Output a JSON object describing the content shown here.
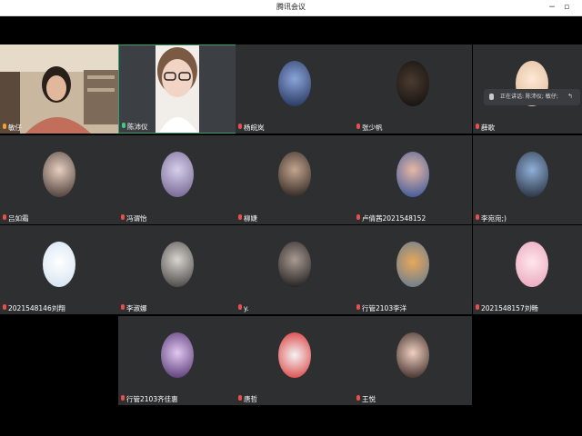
{
  "window": {
    "title": "腾讯会议"
  },
  "speaking_indicator": "正在讲话: 陈沛仪; 敏仔;",
  "colors": {
    "tile_bg": "#2e2f31",
    "active_border": "#2ea56d",
    "mic_muted": "#e94e4e",
    "mic_on": "#47c882"
  },
  "participants": [
    {
      "name": "敏仔",
      "mic": "live",
      "avatar": "bookshelf-video"
    },
    {
      "name": "陈沛仪",
      "mic": "on",
      "avatar": "face-video"
    },
    {
      "name": "杨皖岚",
      "mic": "muted",
      "avatar": "night-portrait"
    },
    {
      "name": "张少帆",
      "mic": "muted",
      "avatar": "dark-silhouette"
    },
    {
      "name": "薛歌",
      "mic": "muted",
      "avatar": "cartoon-girl"
    },
    {
      "name": "吕如霜",
      "mic": "muted",
      "avatar": "girl-photo"
    },
    {
      "name": "冯谓怡",
      "mic": "muted",
      "avatar": "purple-photo"
    },
    {
      "name": "柳婕",
      "mic": "muted",
      "avatar": "dark-girl"
    },
    {
      "name": "卢倩茜2021548152",
      "mic": "muted",
      "avatar": "blue-girl"
    },
    {
      "name": "李宛宛;)",
      "mic": "muted",
      "avatar": "blue-sky"
    },
    {
      "name": "2021548146刘翔",
      "mic": "muted",
      "avatar": "cartoon-sticker"
    },
    {
      "name": "李淑娜",
      "mic": "muted",
      "avatar": "mono-photo"
    },
    {
      "name": "y.",
      "mic": "muted",
      "avatar": "night-girl"
    },
    {
      "name": "行管2103李洋",
      "mic": "muted",
      "avatar": "mountain"
    },
    {
      "name": "2021548157刘畅",
      "mic": "muted",
      "avatar": "pink-fox"
    },
    {
      "name": "行管2103齐佳惠",
      "mic": "muted",
      "avatar": "purple-night"
    },
    {
      "name": "唐哲",
      "mic": "muted",
      "avatar": "flag-emblem"
    },
    {
      "name": "王悦",
      "mic": "muted",
      "avatar": "red-lips"
    }
  ]
}
